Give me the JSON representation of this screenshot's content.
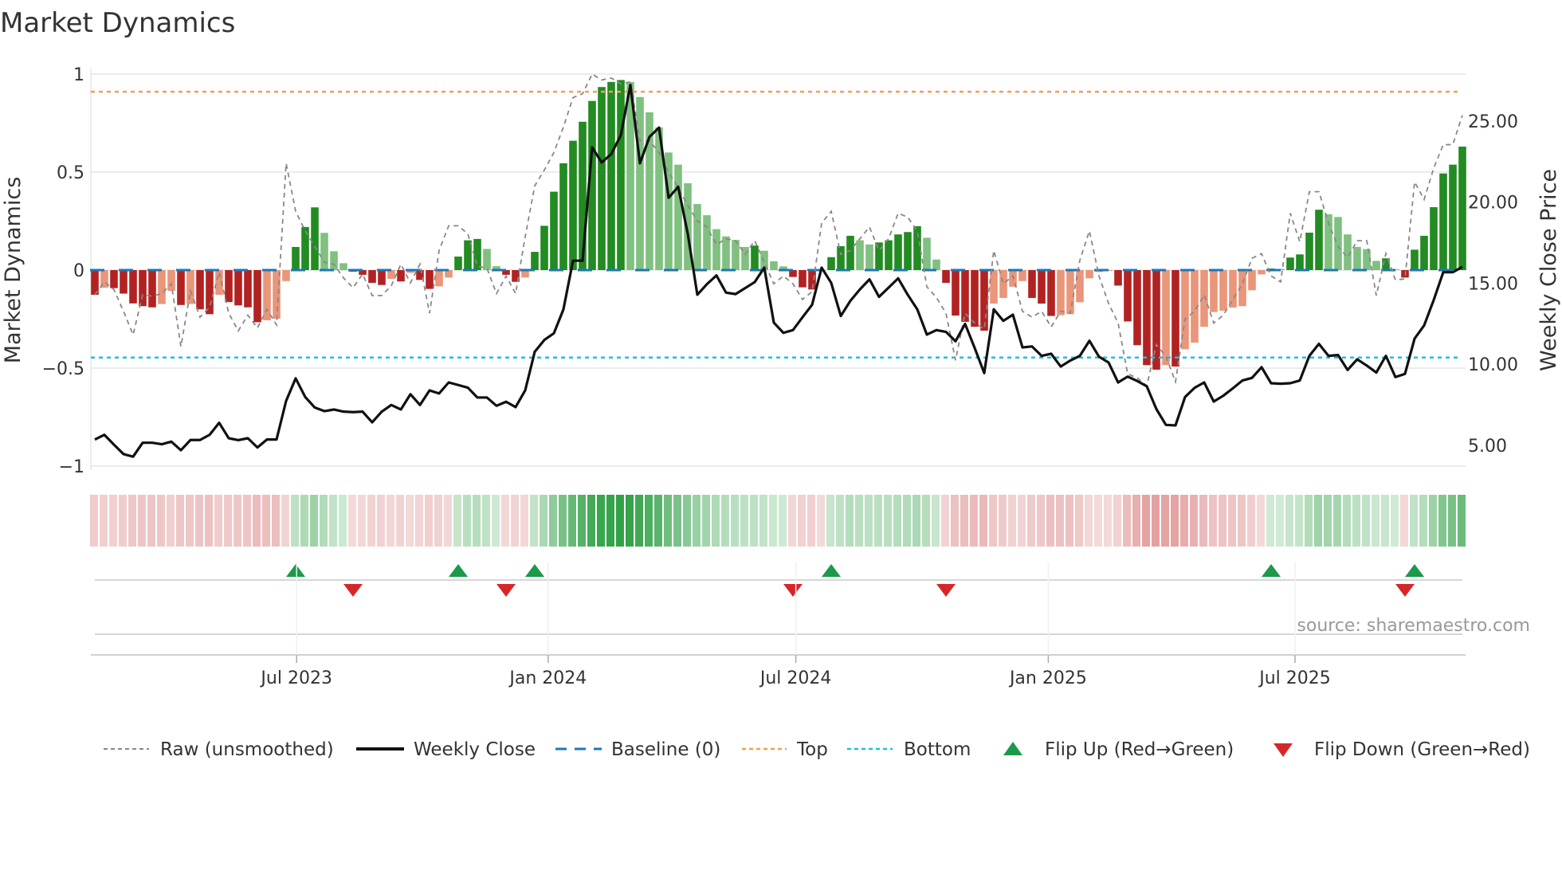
{
  "title": "Market Dynamics",
  "source": "source: sharemaestro.com",
  "colors": {
    "strong_red": "#b22222",
    "fade_red": "#e9967a",
    "strong_green": "#228b22",
    "fade_green": "#80c080",
    "raw": "#888888",
    "price": "#111111",
    "baseline": "#1f77b4",
    "top": "#f0a050",
    "bottom": "#20c0d8",
    "flip_up": "#1a9a4a",
    "flip_down": "#d62728"
  },
  "legend": {
    "raw": "Raw (unsmoothed)",
    "price": "Weekly Close",
    "baseline": "Baseline (0)",
    "top": "Top",
    "bottom": "Bottom",
    "flip_up": "Flip Up (Red→Green)",
    "flip_down": "Flip Down (Green→Red)"
  },
  "chart_data": {
    "type": "bar",
    "title": "Market Dynamics",
    "ylabel": "Market Dynamics",
    "y2label": "Weekly Close Price",
    "ylim": [
      -1,
      1
    ],
    "yticks": [
      1,
      0.5,
      0,
      -0.5,
      -1
    ],
    "ytick_labels": [
      "1",
      "0.5",
      "0",
      "−0.5",
      "−1"
    ],
    "y2lim": [
      3.72,
      27.9
    ],
    "y2ticks": [
      25,
      20,
      15,
      10,
      5
    ],
    "y2tick_labels": [
      "25.00",
      "20.00",
      "15.00",
      "10.00",
      "5.00"
    ],
    "top_level": 0.91,
    "bottom_level": -0.446,
    "baseline": 0,
    "x_ticks": [
      {
        "label": "Jul 2023",
        "week_pos": 21.1
      },
      {
        "label": "Jan 2024",
        "week_pos": 47.4
      },
      {
        "label": "Jul 2024",
        "week_pos": 73.3
      },
      {
        "label": "Jan 2025",
        "week_pos": 99.7
      },
      {
        "label": "Jul 2025",
        "week_pos": 125.5
      }
    ],
    "dynamics": [
      -0.126,
      -0.09,
      -0.092,
      -0.12,
      -0.17,
      -0.184,
      -0.19,
      -0.173,
      -0.106,
      -0.178,
      -0.173,
      -0.2,
      -0.225,
      -0.126,
      -0.163,
      -0.18,
      -0.19,
      -0.266,
      -0.256,
      -0.248,
      -0.056,
      0.118,
      0.22,
      0.32,
      0.19,
      0.096,
      0.035,
      -0.008,
      -0.024,
      -0.065,
      -0.076,
      -0.045,
      -0.058,
      -0.014,
      -0.05,
      -0.096,
      -0.083,
      -0.038,
      0.069,
      0.152,
      0.159,
      0.108,
      0.02,
      -0.024,
      -0.06,
      -0.038,
      0.093,
      0.226,
      0.4,
      0.545,
      0.66,
      0.757,
      0.863,
      0.934,
      0.96,
      0.97,
      0.96,
      0.883,
      0.805,
      0.728,
      0.6,
      0.538,
      0.443,
      0.337,
      0.28,
      0.209,
      0.172,
      0.154,
      0.118,
      0.125,
      0.099,
      0.045,
      0.019,
      -0.035,
      -0.088,
      -0.099,
      -0.005,
      0.066,
      0.122,
      0.175,
      0.152,
      0.131,
      0.141,
      0.152,
      0.182,
      0.194,
      0.224,
      0.165,
      0.054,
      -0.065,
      -0.232,
      -0.264,
      -0.289,
      -0.309,
      -0.171,
      -0.142,
      -0.085,
      -0.056,
      -0.142,
      -0.171,
      -0.234,
      -0.23,
      -0.225,
      -0.164,
      -0.042,
      -0.01,
      -0.004,
      -0.079,
      -0.262,
      -0.383,
      -0.485,
      -0.508,
      -0.485,
      -0.492,
      -0.404,
      -0.37,
      -0.289,
      -0.214,
      -0.207,
      -0.191,
      -0.184,
      -0.103,
      -0.022,
      0.008,
      0.006,
      0.064,
      0.08,
      0.191,
      0.308,
      0.285,
      0.271,
      0.182,
      0.118,
      0.107,
      0.047,
      0.06,
      0.004,
      -0.038,
      0.104,
      0.175,
      0.321,
      0.493,
      0.538,
      0.63
    ],
    "raw": [
      -0.126,
      -0.06,
      -0.1,
      -0.21,
      -0.33,
      -0.126,
      -0.133,
      -0.12,
      -0.07,
      -0.39,
      -0.106,
      -0.24,
      -0.19,
      -0.01,
      -0.22,
      -0.31,
      -0.23,
      -0.295,
      -0.2,
      -0.28,
      0.545,
      0.3,
      0.2,
      0.12,
      0.04,
      0.03,
      -0.04,
      -0.09,
      -0.02,
      -0.13,
      -0.13,
      -0.08,
      0.03,
      -0.065,
      0.03,
      -0.22,
      0.1,
      0.226,
      0.226,
      0.185,
      0.02,
      0.01,
      -0.12,
      -0.03,
      -0.12,
      0.17,
      0.43,
      0.51,
      0.6,
      0.73,
      0.88,
      0.9,
      1.0,
      0.97,
      0.98,
      0.95,
      0.96,
      0.66,
      0.66,
      0.6,
      0.5,
      0.42,
      0.33,
      0.25,
      0.22,
      0.13,
      0.16,
      0.15,
      0.08,
      0.15,
      0.04,
      -0.07,
      -0.03,
      -0.07,
      -0.15,
      -0.11,
      0.24,
      0.3,
      0.08,
      0.1,
      0.16,
      0.22,
      0.1,
      0.16,
      0.29,
      0.27,
      0.2,
      -0.085,
      -0.14,
      -0.22,
      -0.46,
      -0.22,
      -0.27,
      -0.3,
      0.1,
      -0.07,
      -0.03,
      -0.21,
      -0.24,
      -0.21,
      -0.29,
      -0.21,
      -0.22,
      0.05,
      0.2,
      -0.03,
      -0.17,
      -0.27,
      -0.53,
      -0.55,
      -0.59,
      -0.38,
      -0.44,
      -0.57,
      -0.25,
      -0.21,
      -0.126,
      -0.27,
      -0.23,
      -0.15,
      -0.07,
      0.06,
      0.084,
      -0.03,
      -0.06,
      0.29,
      0.145,
      0.4,
      0.4,
      0.24,
      0.12,
      0.064,
      0.15,
      0.15,
      -0.13,
      0.084,
      -0.05,
      -0.045,
      0.45,
      0.36,
      0.52,
      0.64,
      0.64,
      0.79
    ],
    "weekly_close": [
      5.36,
      5.65,
      5.04,
      4.46,
      4.3,
      5.16,
      5.16,
      5.07,
      5.23,
      4.7,
      5.33,
      5.33,
      5.65,
      6.39,
      5.44,
      5.32,
      5.44,
      4.87,
      5.36,
      5.36,
      7.74,
      9.13,
      7.98,
      7.33,
      7.11,
      7.21,
      7.08,
      7.05,
      7.08,
      6.42,
      7.08,
      7.49,
      7.21,
      8.15,
      7.49,
      8.39,
      8.2,
      8.88,
      8.72,
      8.56,
      7.95,
      7.95,
      7.44,
      7.69,
      7.36,
      8.39,
      10.77,
      11.5,
      11.91,
      13.39,
      16.39,
      16.39,
      23.38,
      22.45,
      22.97,
      24.12,
      27.23,
      22.4,
      24.03,
      24.6,
      20.27,
      20.95,
      18.05,
      14.29,
      14.94,
      15.48,
      14.42,
      14.33,
      14.7,
      15.07,
      15.96,
      12.57,
      11.94,
      12.11,
      12.9,
      13.67,
      15.96,
      15.02,
      12.98,
      13.91,
      14.62,
      15.24,
      14.16,
      14.73,
      15.3,
      14.29,
      13.39,
      11.83,
      12.11,
      12.0,
      11.42,
      12.49,
      11.01,
      9.46,
      13.39,
      12.68,
      13.06,
      11.04,
      11.1,
      10.52,
      10.65,
      9.86,
      10.23,
      10.52,
      11.45,
      10.47,
      10.11,
      8.88,
      9.24,
      8.97,
      8.64,
      7.24,
      6.26,
      6.23,
      7.98,
      8.55,
      8.88,
      7.7,
      8.06,
      8.52,
      9.0,
      9.16,
      9.82,
      8.83,
      8.8,
      8.83,
      9.0,
      10.52,
      11.26,
      10.52,
      10.57,
      9.65,
      10.31,
      9.92,
      9.49,
      10.52,
      9.21,
      9.41,
      11.58,
      12.4,
      13.96,
      15.68,
      15.68,
      16.01
    ],
    "flip_up_weeks": [
      22,
      39,
      47,
      78,
      124,
      139
    ],
    "flip_down_weeks": [
      28,
      44,
      74,
      90,
      138
    ]
  }
}
